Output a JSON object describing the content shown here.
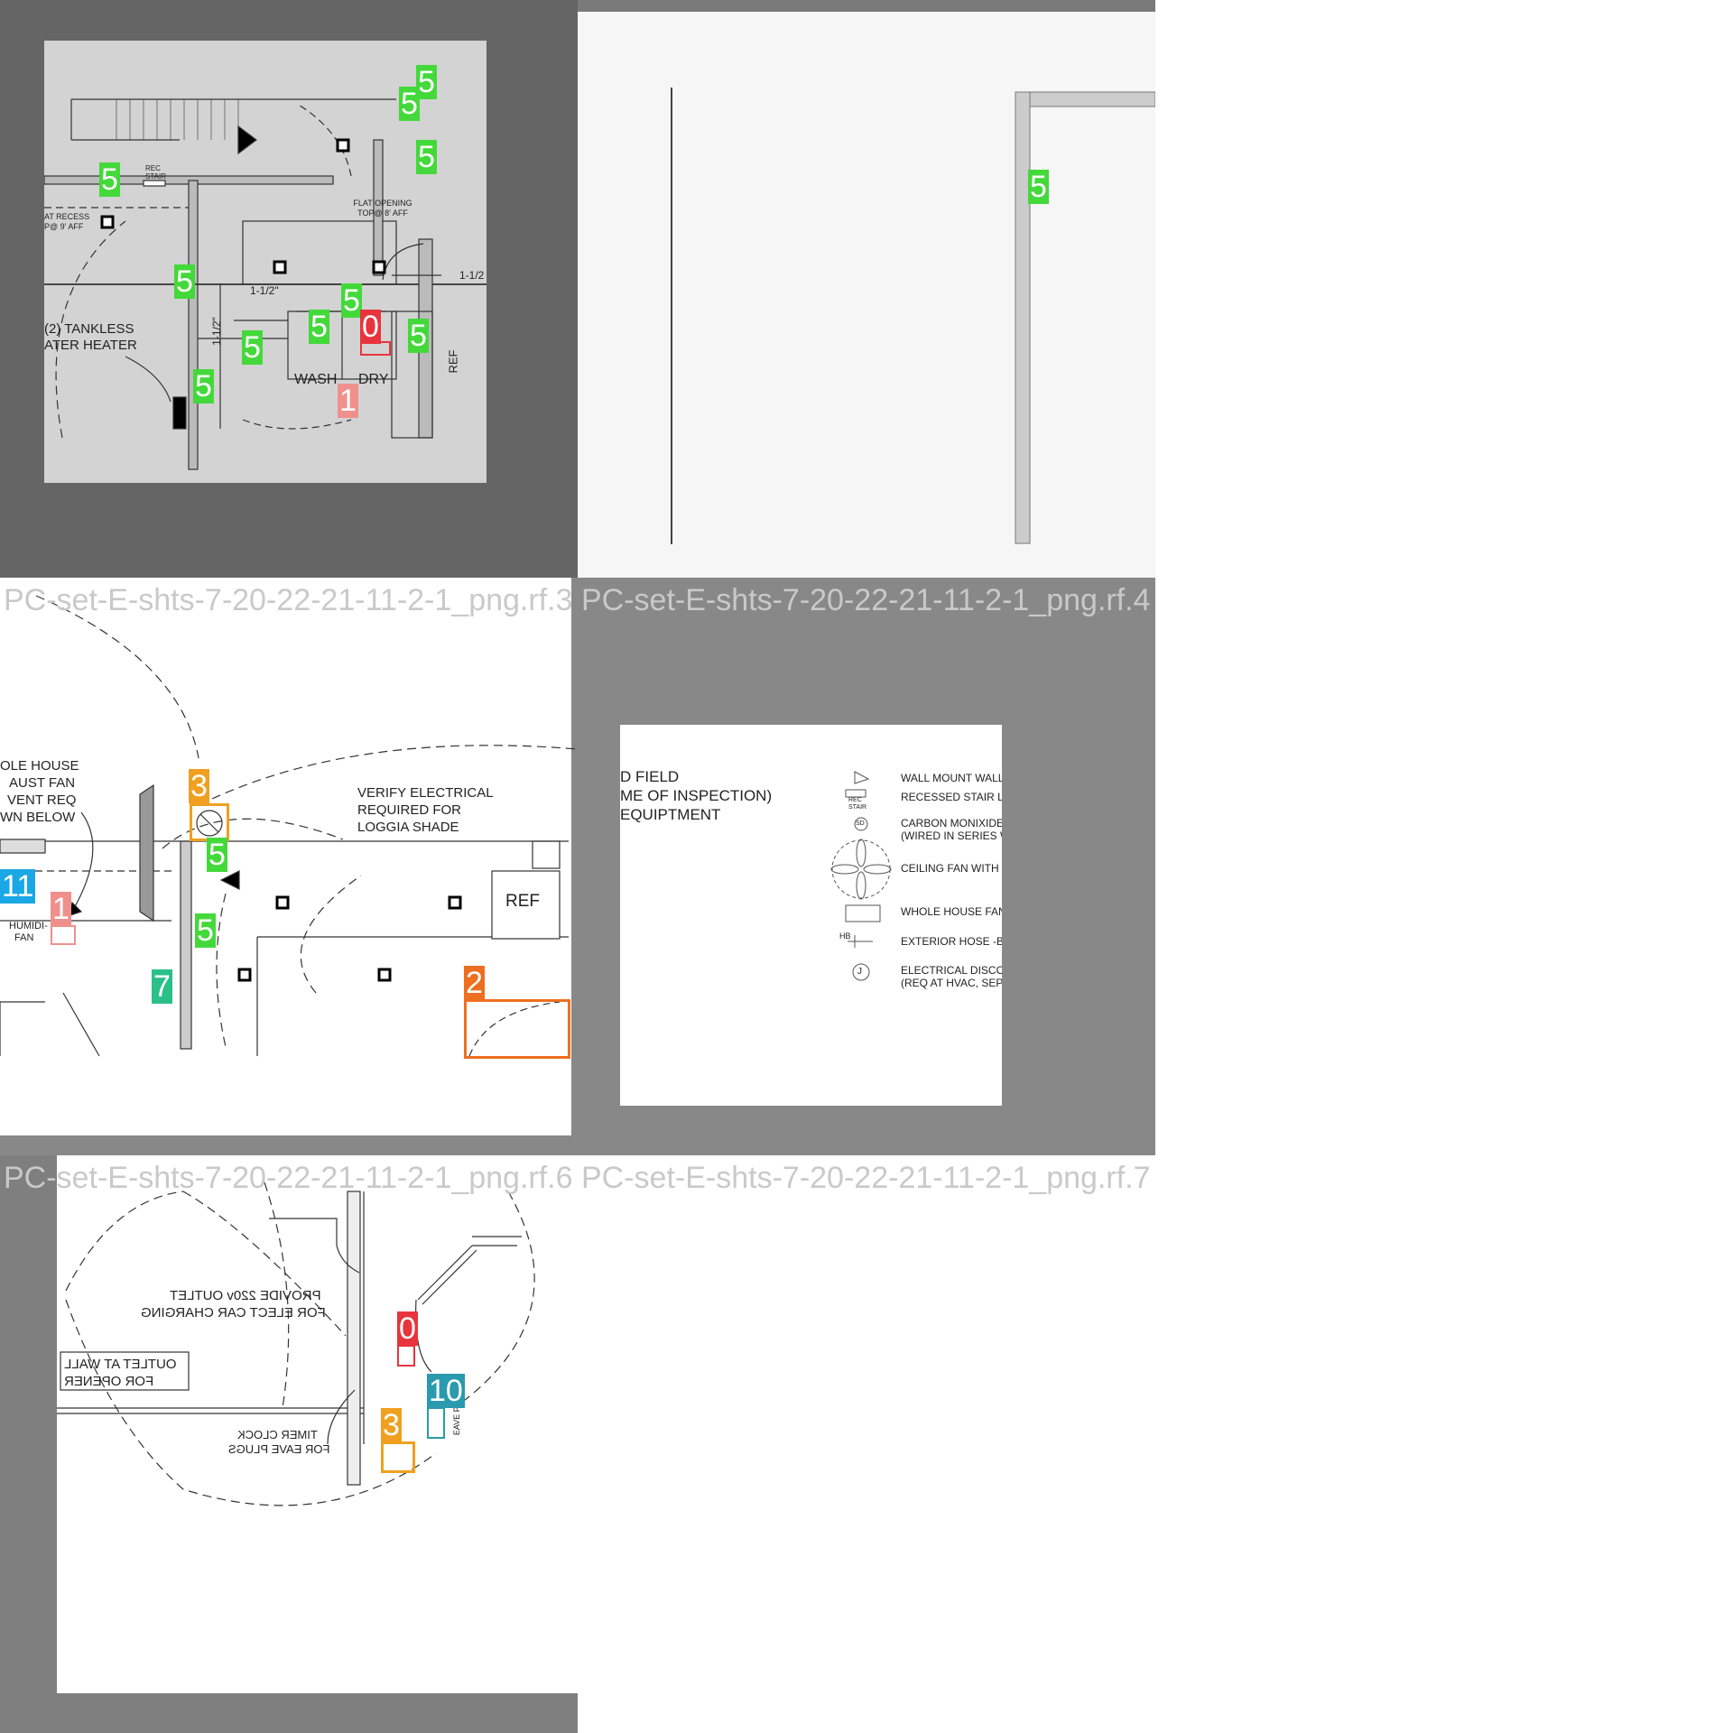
{
  "colors": {
    "green": "#43d93a",
    "red": "#e8343c",
    "pink": "#f0908c",
    "orange": "#f0a020",
    "dark_orange": "#ee6f20",
    "cyan": "#1aa7e6",
    "teal": "#2bbf8a",
    "blue_teal": "#2a9aae",
    "gray_frame": "#656565",
    "gray_frame_2": "#888888"
  },
  "tiles": [
    {
      "caption": "",
      "labels": {
        "rec_stair": "REC STAIR",
        "flat_opening": "FLAT OPENING TOP@ 8' AFF",
        "flat_recess": "AT RECESS P@ 9' AFF",
        "dim1": "1-1/2\"",
        "dim2": "1-1/2\"",
        "dim3": "1-1/2",
        "tankless1": "(2) TANKLESS",
        "tankless2": "ATER HEATER",
        "wash": "WASH",
        "dry": "DRY",
        "ref": "REF"
      },
      "badges": [
        "5",
        "5",
        "5",
        "5",
        "5",
        "5",
        "5",
        "5",
        "5",
        "0",
        "1"
      ]
    },
    {
      "caption": "",
      "badges": [
        "5"
      ]
    },
    {
      "caption": "PC-set-E-shts-7-20-22-21-11-2-1_png.rf.3",
      "labels": {
        "whole1": "OLE HOUSE",
        "whole2": "AUST FAN",
        "whole3": "VENT REQ",
        "whole4": "WN BELOW",
        "verify1": "VERIFY ELECTRICAL",
        "verify2": "REQUIRED FOR",
        "verify3": "LOGGIA SHADE",
        "ref": "REF",
        "humid": "HUMIDI-",
        "fan": "FAN"
      },
      "badges": [
        "3",
        "5",
        "5",
        "11",
        "1",
        "7",
        "2"
      ]
    },
    {
      "caption": "PC-set-E-shts-7-20-22-21-11-2-1_png.rf.4",
      "labels": {
        "left1": "D FIELD",
        "left2": "ME OF INSPECTION)",
        "left3": "EQUIPTMENT",
        "l1": "WALL MOUNT WALL",
        "l2": "RECESSED STAIR L",
        "l3a": "CARBON MONIXIDE",
        "l3b": "(WIRED IN SERIES W",
        "l4": "CEILING FAN WITH L",
        "l5": "WHOLE HOUSE FAN",
        "l6": "EXTERIOR HOSE -B",
        "l7a": "ELECTRICAL DISCO",
        "l7b": "(REQ AT HVAC, SEP",
        "sym_rec": "REC STAIR",
        "sym_sd": "SD",
        "sym_hb": "HB",
        "sym_j": "J"
      }
    },
    {
      "caption": "PC-set-E-shts-7-20-22-21-11-2-1_png.rf.6",
      "labels": {
        "provide1": "PROVIDE 220v OUTLET",
        "provide2": "FOR ELECT CAR CHARGING",
        "outlet1": "OUTLET AT WALL",
        "outlet2": "FOR OPENER",
        "timer1": "TIMER CLOCK",
        "timer2": "FOR EAVE PLUGS",
        "eave": "EAVE PLUG"
      },
      "badges": [
        "0",
        "10",
        "3"
      ]
    },
    {
      "caption": "PC-set-E-shts-7-20-22-21-11-2-1_png.rf.7"
    }
  ]
}
